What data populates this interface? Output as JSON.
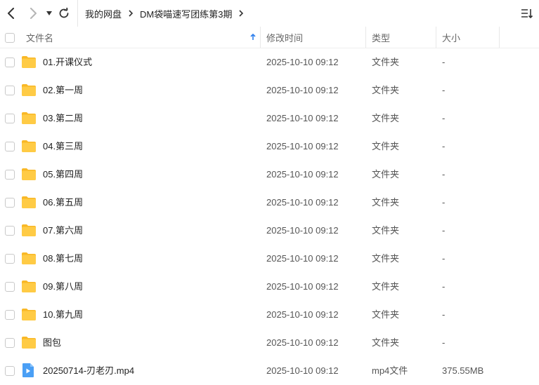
{
  "toolbar": {
    "icons": [
      "back-arrow-icon",
      "forward-arrow-icon",
      "dropdown-caret-icon",
      "refresh-icon",
      "sort-list-icon"
    ],
    "breadcrumb": [
      "我的网盘",
      "DM袋喵速写团练第3期"
    ]
  },
  "header": {
    "name_label": "文件名",
    "modified_label": "修改时间",
    "type_label": "类型",
    "size_label": "大小"
  },
  "colors": {
    "folder": "#FFC83D",
    "video": "#4A9FF5",
    "sort_arrow": "#2F80ED"
  },
  "files": [
    {
      "name": "01.开课仪式",
      "modified": "2025-10-10 09:12",
      "type": "文件夹",
      "size": "-",
      "icon": "folder-icon"
    },
    {
      "name": "02.第一周",
      "modified": "2025-10-10 09:12",
      "type": "文件夹",
      "size": "-",
      "icon": "folder-icon"
    },
    {
      "name": "03.第二周",
      "modified": "2025-10-10 09:12",
      "type": "文件夹",
      "size": "-",
      "icon": "folder-icon"
    },
    {
      "name": "04.第三周",
      "modified": "2025-10-10 09:12",
      "type": "文件夹",
      "size": "-",
      "icon": "folder-icon"
    },
    {
      "name": "05.第四周",
      "modified": "2025-10-10 09:12",
      "type": "文件夹",
      "size": "-",
      "icon": "folder-icon"
    },
    {
      "name": "06.第五周",
      "modified": "2025-10-10 09:12",
      "type": "文件夹",
      "size": "-",
      "icon": "folder-icon"
    },
    {
      "name": "07.第六周",
      "modified": "2025-10-10 09:12",
      "type": "文件夹",
      "size": "-",
      "icon": "folder-icon"
    },
    {
      "name": "08.第七周",
      "modified": "2025-10-10 09:12",
      "type": "文件夹",
      "size": "-",
      "icon": "folder-icon"
    },
    {
      "name": "09.第八周",
      "modified": "2025-10-10 09:12",
      "type": "文件夹",
      "size": "-",
      "icon": "folder-icon"
    },
    {
      "name": "10.第九周",
      "modified": "2025-10-10 09:12",
      "type": "文件夹",
      "size": "-",
      "icon": "folder-icon"
    },
    {
      "name": "图包",
      "modified": "2025-10-10 09:12",
      "type": "文件夹",
      "size": "-",
      "icon": "folder-icon"
    },
    {
      "name": "20250714-刃老刃.mp4",
      "modified": "2025-10-10 09:12",
      "type": "mp4文件",
      "size": "375.55MB",
      "icon": "video-file-icon"
    }
  ]
}
